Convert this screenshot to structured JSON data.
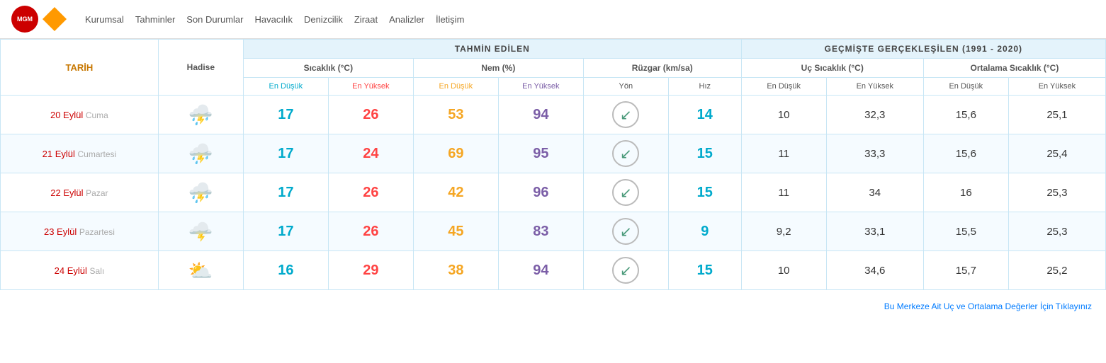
{
  "nav": {
    "items": [
      "Kurumsal",
      "Tahminler",
      "Son Durumlar",
      "Havacılık",
      "Denizcilik",
      "Ziraat",
      "Analizler",
      "İletişim"
    ]
  },
  "table": {
    "section_tahmin": "TAHMİN EDİLEN",
    "section_gecmis": "GEÇMİŞTE GERÇEKLEŞİLEN (1991 - 2020)",
    "col_tarih": "TARİH",
    "col_hadise": "Hadise",
    "col_sicaklik": "Sıcaklık (°C)",
    "col_nem": "Nem (%)",
    "col_ruzgar": "Rüzgar (km/sa)",
    "col_uc_sicaklik": "Uç Sıcaklık (°C)",
    "col_ort_sicaklik": "Ortalama Sıcaklık (°C)",
    "col_en_dusuk": "En Düşük",
    "col_en_yuksek": "En Yüksek",
    "col_yon": "Yön",
    "col_hiz": "Hız",
    "rows": [
      {
        "tarih": "20 Eylül Cuma",
        "hadise_icon": "storm_rain",
        "sic_low": "17",
        "sic_high": "26",
        "nem_low": "53",
        "nem_high": "94",
        "yon_icon": "↙",
        "hiz": "14",
        "uc_low": "10",
        "uc_high": "32,3",
        "ort_low": "15,6",
        "ort_high": "25,1"
      },
      {
        "tarih": "21 Eylül Cumartesi",
        "hadise_icon": "storm_rain",
        "sic_low": "17",
        "sic_high": "24",
        "nem_low": "69",
        "nem_high": "95",
        "yon_icon": "↙",
        "hiz": "15",
        "uc_low": "11",
        "uc_high": "33,3",
        "ort_low": "15,6",
        "ort_high": "25,4"
      },
      {
        "tarih": "22 Eylül Pazar",
        "hadise_icon": "storm_rain",
        "sic_low": "17",
        "sic_high": "26",
        "nem_low": "42",
        "nem_high": "96",
        "yon_icon": "↙",
        "hiz": "15",
        "uc_low": "11",
        "uc_high": "34",
        "ort_low": "16",
        "ort_high": "25,3"
      },
      {
        "tarih": "23 Eylül Pazartesi",
        "hadise_icon": "storm_cloud",
        "sic_low": "17",
        "sic_high": "26",
        "nem_low": "45",
        "nem_high": "83",
        "yon_icon": "↙",
        "hiz": "9",
        "uc_low": "9,2",
        "uc_high": "33,1",
        "ort_low": "15,5",
        "ort_high": "25,3"
      },
      {
        "tarih": "24 Eylül Salı",
        "hadise_icon": "sunny_cloudy",
        "sic_low": "16",
        "sic_high": "29",
        "nem_low": "38",
        "nem_high": "94",
        "yon_icon": "↙",
        "hiz": "15",
        "uc_low": "10",
        "uc_high": "34,6",
        "ort_low": "15,7",
        "ort_high": "25,2"
      }
    ],
    "footer_link": "Bu Merkeze Ait Uç ve Ortalama Değerler İçin Tıklayınız"
  }
}
